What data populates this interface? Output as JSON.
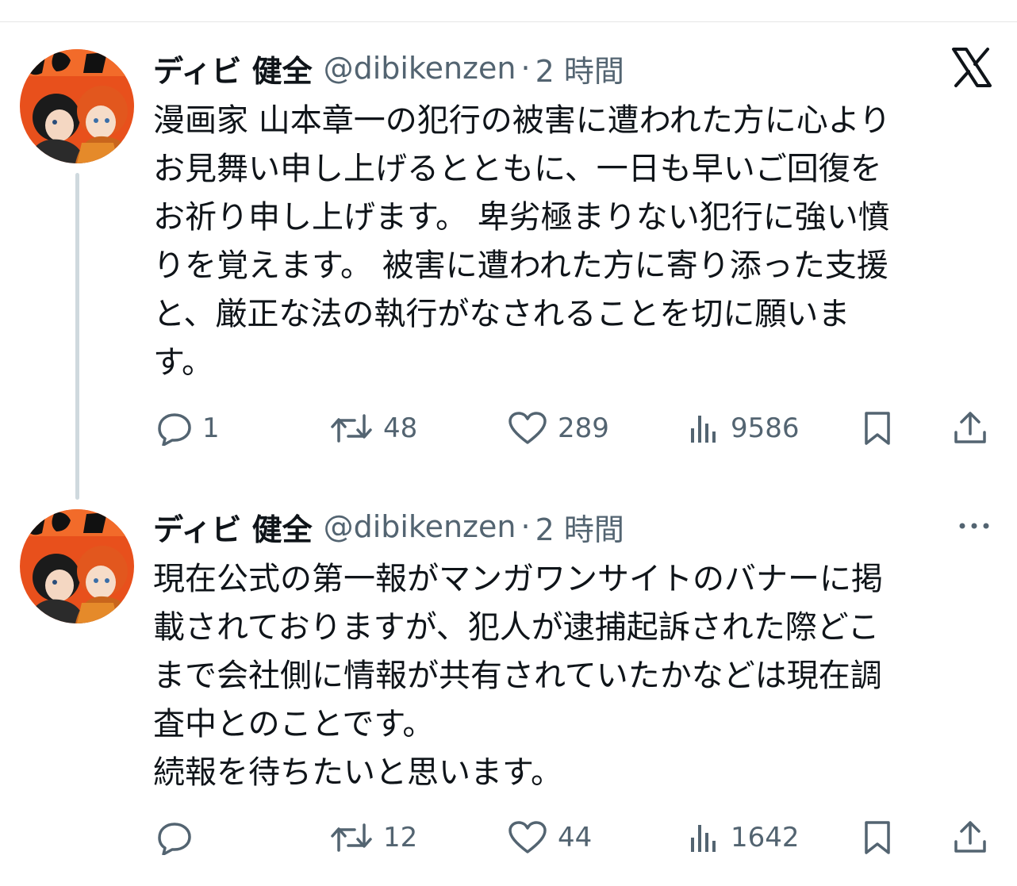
{
  "tweets": [
    {
      "display_name": "ディビ 健全",
      "handle": "@dibikenzen",
      "separator": "·",
      "time": "2 時間",
      "text": "漫画家 山本章一の犯行の被害に遭われた方に心より\nお見舞い申し上げるとともに、一日も早いご回復を\nお祈り申し上げます。 卑劣極まりない犯行に強い憤\nりを覚えます。 被害に遭われた方に寄り添った支援\nと、厳正な法の執行がなされることを切に願いま\nす。",
      "replies": "1",
      "reposts": "48",
      "likes": "289",
      "views": "9586"
    },
    {
      "display_name": "ディビ 健全",
      "handle": "@dibikenzen",
      "separator": "·",
      "time": "2 時間",
      "text": "現在公式の第一報がマンガワンサイトのバナーに掲\n載されておりますが、犯人が逮捕起訴された際どこ\nまで会社側に情報が共有されていたかなどは現在調\n査中とのことです。\n続報を待ちたいと思います。",
      "replies": "",
      "reposts": "12",
      "likes": "44",
      "views": "1642"
    }
  ],
  "icons": {
    "platform_logo": "x-logo-icon",
    "more": "more-icon",
    "reply": "reply-icon",
    "repost": "repost-icon",
    "like": "heart-icon",
    "views": "views-icon",
    "bookmark": "bookmark-icon",
    "share": "share-icon"
  },
  "colors": {
    "text_primary": "#0f1419",
    "text_secondary": "#536471",
    "thread_line": "#cfd9de",
    "avatar_bg": "#e8501c"
  }
}
